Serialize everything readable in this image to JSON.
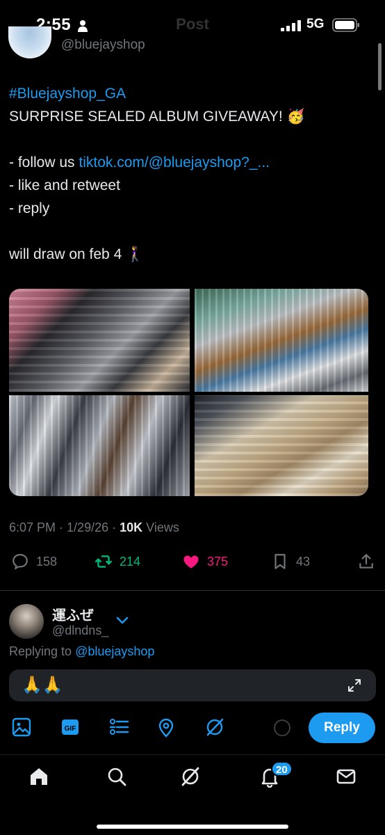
{
  "status_bar": {
    "time": "2:55",
    "network": "5G",
    "page_title": "Post"
  },
  "tweet": {
    "author_handle": "@bluejayshop",
    "lines": [
      {
        "hashtag": "#Bluejayshop_GA"
      },
      {
        "text": "SURPRISE SEALED ALBUM GIVEAWAY! 🥳"
      },
      {
        "prefix": "- follow us ",
        "link": "tiktok.com/@bluejayshop?_..."
      },
      {
        "text": "- like and retweet"
      },
      {
        "text": "- reply"
      },
      {
        "text": "will draw on feb 4 🚶‍♀️"
      }
    ],
    "meta": {
      "time": "6:07 PM",
      "date": "1/29/26",
      "views_count": "10K",
      "views_label": "Views"
    },
    "stats": {
      "replies": "158",
      "retweets": "214",
      "likes": "375",
      "bookmarks": "43"
    },
    "media_names": [
      "album-stacks-photo",
      "store-shelves-photo",
      "album-rows-photo",
      "sealed-albums-photo"
    ]
  },
  "reply": {
    "user_name": "運ふぜ",
    "user_handle": "@dlndns_",
    "replying_prefix": "Replying to ",
    "replying_to": "@bluejayshop",
    "input_value": "🙏🙏",
    "button_label": "Reply"
  },
  "nav": {
    "notifications_badge": "20"
  },
  "colors": {
    "accent": "#1d9bf0",
    "retweet": "#00ba7c",
    "like": "#f91880",
    "muted": "#71767b",
    "background": "#000000"
  },
  "icons": {
    "toolbar": [
      "image-icon",
      "gif-icon",
      "poll-icon",
      "location-icon",
      "grok-icon"
    ],
    "nav": [
      "home-icon",
      "search-icon",
      "grok-icon",
      "notifications-icon",
      "messages-icon"
    ]
  }
}
